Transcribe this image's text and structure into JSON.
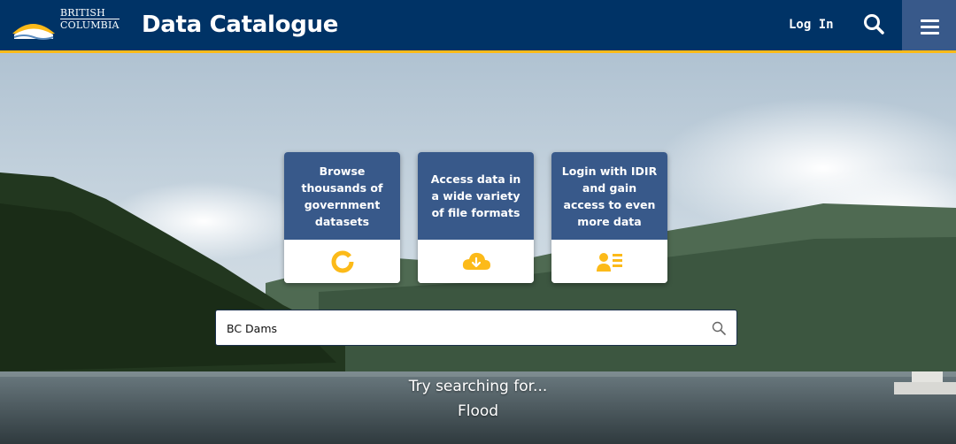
{
  "header": {
    "logo_line1": "BRITISH",
    "logo_line2": "COLUMBIA",
    "title": "Data Catalogue",
    "login_label": "Log In",
    "search_icon": "search-icon",
    "menu_icon": "hamburger-menu-icon"
  },
  "cards": [
    {
      "label": "Browse thousands of government datasets",
      "icon": "ring-chart-icon"
    },
    {
      "label": "Access data in a wide variety of file formats",
      "icon": "cloud-download-icon"
    },
    {
      "label": "Login with IDIR and gain access to even more data",
      "icon": "user-list-icon"
    }
  ],
  "search": {
    "value": "BC Dams",
    "icon": "search-icon"
  },
  "suggestions": {
    "heading": "Try searching for...",
    "example": "Flood"
  },
  "colors": {
    "header_bg": "#003366",
    "accent_gold": "#fcba19",
    "card_blue": "#38598a",
    "icon_gold": "#fcba19"
  }
}
